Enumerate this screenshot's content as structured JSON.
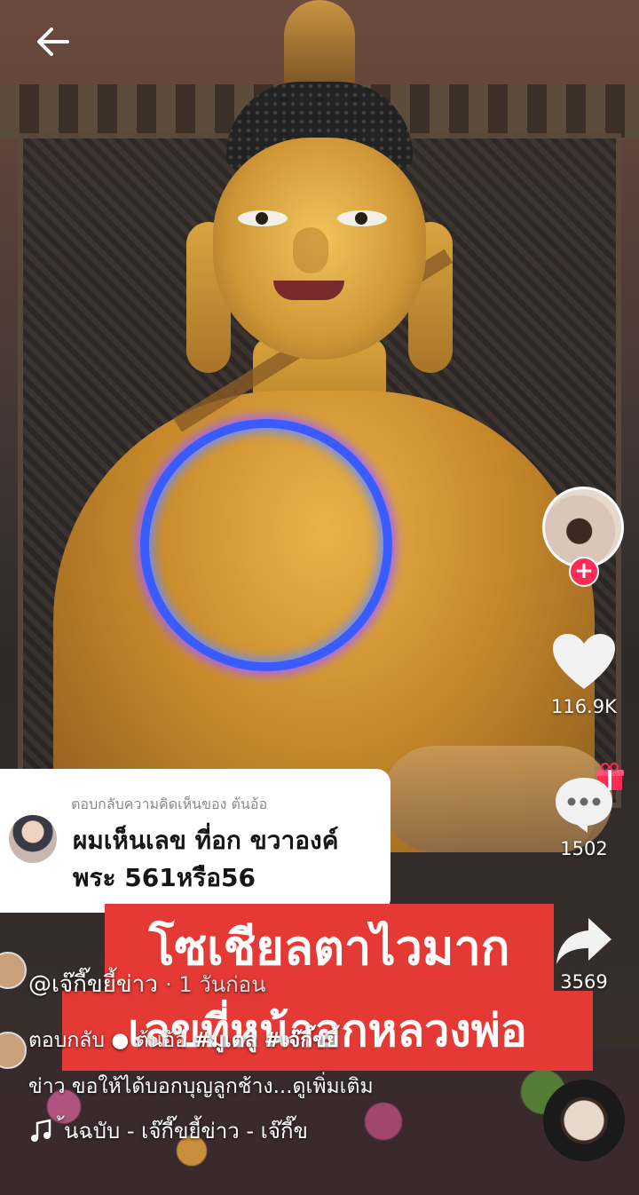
{
  "reply_card": {
    "header": "ตอบกลับความคิดเห็นของ ต้นอ้อ",
    "text_line1": "ผมเห็นเลข ที่อก ขวาองค์",
    "text_line2": "พระ 561หรือ56"
  },
  "caption": {
    "line1": "โซเชียลตาไวมาก",
    "line2": "เลขที่หน้าอกหลวงพ่อ"
  },
  "actions": {
    "likes": "116.9K",
    "comments": "1502",
    "shares": "3569"
  },
  "post": {
    "username": "@เจ๊กี๊ขยี้ข่าว",
    "time": "· 1 วันก่อน",
    "desc_prefix": "ตอบกลับ",
    "mention": "ต้นอ้อ",
    "hashtags": "#มูเตลู #เจ๊กี๊ขยี้",
    "desc_line2": "ข่าว ขอให้ได้บอกบุญลูกช้าง...ดูเพิ่มเติม"
  },
  "music": {
    "text": "้นฉบับ - เจ๊กี๊ขยี้ข่าว - เจ๊กี๊ข"
  },
  "colors": {
    "caption_bg": "#e53935",
    "follow": "#fe2c55",
    "ring": "#3a5cff"
  },
  "icons": [
    "back-arrow-icon",
    "heart-icon",
    "comment-icon",
    "share-icon",
    "gift-icon",
    "music-note-icon",
    "plus-icon"
  ]
}
